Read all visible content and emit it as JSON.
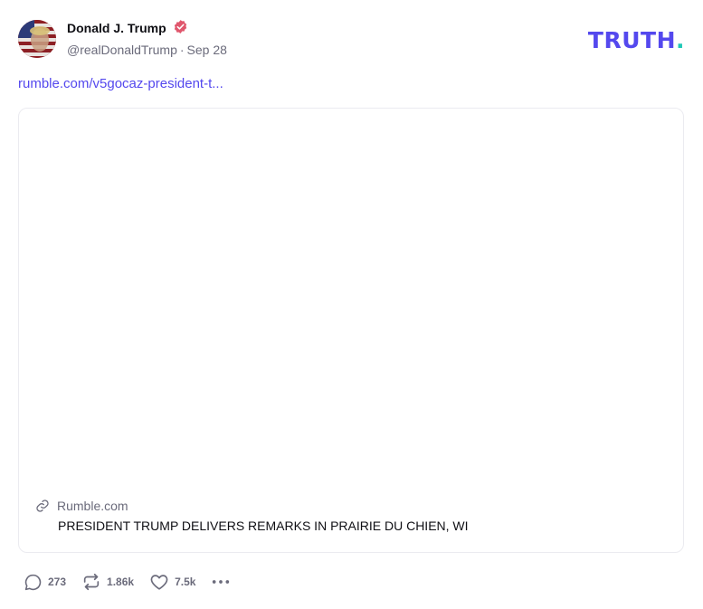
{
  "post": {
    "author": {
      "display_name": "Donald J. Trump",
      "handle": "@realDonaldTrump",
      "date": "Sep 28",
      "verified": true
    },
    "link_text": "rumble.com/v5gocaz-president-t...",
    "card": {
      "domain": "Rumble.com",
      "title": "PRESIDENT TRUMP DELIVERS REMARKS IN PRAIRIE DU CHIEN, WI"
    },
    "actions": {
      "replies": "273",
      "retruths": "1.86k",
      "likes": "7.5k"
    }
  },
  "brand": {
    "logo_main": "TRUTH",
    "logo_accent": ".",
    "color_primary": "#5448ee",
    "color_accent": "#1fc8b6",
    "verified_color": "#e0576d"
  },
  "icons": [
    "verified-badge-icon",
    "link-icon",
    "reply-icon",
    "retruth-icon",
    "like-icon",
    "more-icon"
  ]
}
